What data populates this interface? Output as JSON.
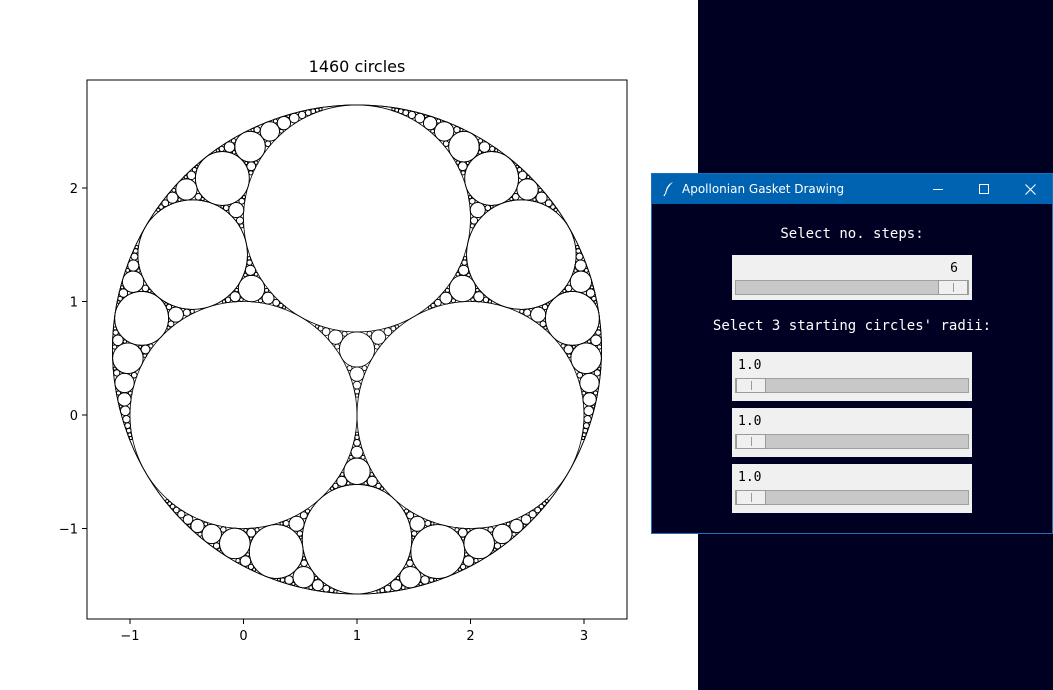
{
  "plot": {
    "title": "1460 circles",
    "x_ticks": [
      "−1",
      "0",
      "1",
      "2",
      "3"
    ],
    "y_ticks": [
      "2",
      "1",
      "0",
      "−1"
    ]
  },
  "chart_data": {
    "type": "scatter",
    "title": "1460 circles",
    "xlim": [
      -1.38,
      3.38
    ],
    "ylim": [
      -1.8,
      2.94
    ],
    "x_ticks": [
      -1,
      0,
      1,
      2,
      3
    ],
    "y_ticks": [
      -1,
      0,
      1,
      2
    ],
    "outer_circle": {
      "cx": 1.0,
      "cy": 0.577,
      "r": 2.155
    },
    "initial_circles": [
      {
        "cx": 0.0,
        "cy": 0.0,
        "r": 1.0
      },
      {
        "cx": 2.0,
        "cy": 0.0,
        "r": 1.0
      },
      {
        "cx": 1.0,
        "cy": 1.732,
        "r": 1.0
      }
    ],
    "circle_count": 1460
  },
  "dialog": {
    "title": "Apollonian Gasket Drawing",
    "steps_label": "Select no. steps:",
    "steps_value": "6",
    "steps_fraction": 1.0,
    "radii_label": "Select 3 starting circles' radii:",
    "radii": [
      {
        "value": "1.0",
        "fraction": 0.0
      },
      {
        "value": "1.0",
        "fraction": 0.0
      },
      {
        "value": "1.0",
        "fraction": 0.0
      }
    ]
  }
}
